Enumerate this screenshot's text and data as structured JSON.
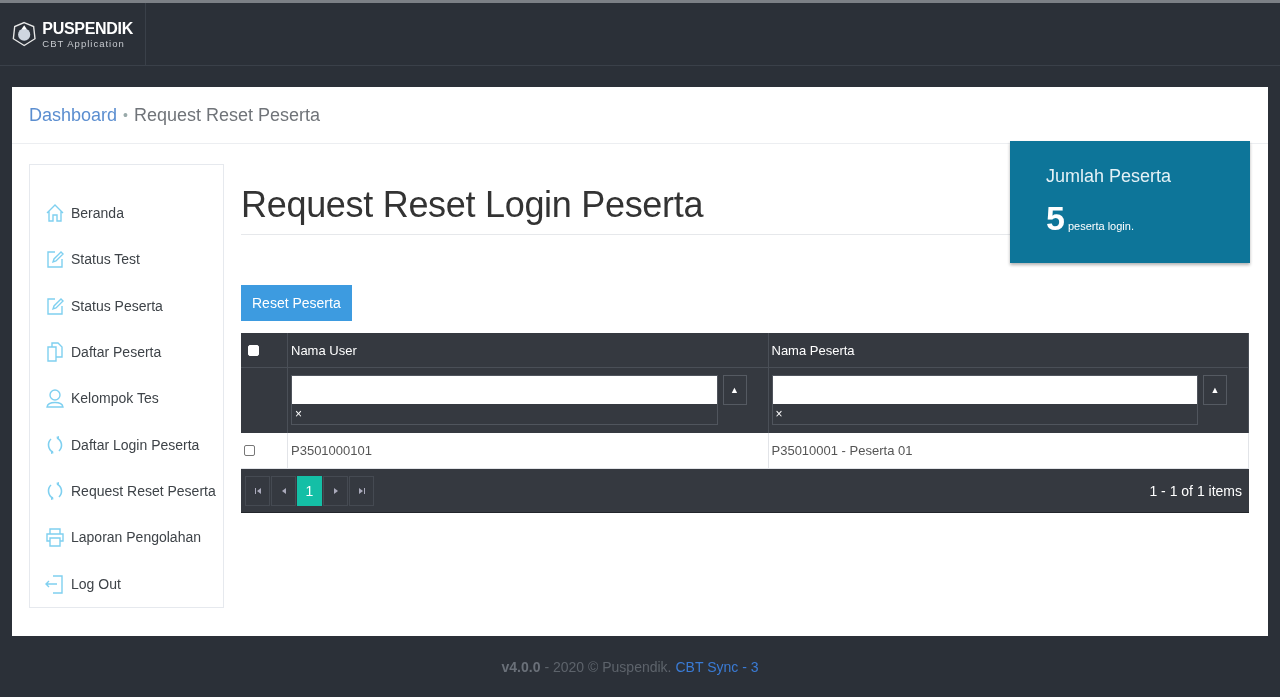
{
  "header": {
    "brand": "PUSPENDIK",
    "subtitle": "CBT Application"
  },
  "breadcrumb": {
    "items": [
      {
        "label": "Dashboard",
        "kind": "link"
      },
      {
        "label": "Request Reset Peserta",
        "kind": "current"
      }
    ],
    "separator": "•"
  },
  "sidebar": {
    "items": [
      {
        "label": "Beranda",
        "kind": "home"
      },
      {
        "label": "Status Test",
        "kind": "edit"
      },
      {
        "label": "Status Peserta",
        "kind": "edit"
      },
      {
        "label": "Daftar Peserta",
        "kind": "document"
      },
      {
        "label": "Kelompok Tes",
        "kind": "user"
      },
      {
        "label": "Daftar Login Peserta",
        "kind": "refresh"
      },
      {
        "label": "Request Reset Peserta",
        "kind": "refresh"
      },
      {
        "label": "Laporan Pengolahan",
        "kind": "printer"
      },
      {
        "label": "Log Out",
        "kind": "logout"
      }
    ]
  },
  "page_title": "Request Reset Login Peserta",
  "stat_card": {
    "title": "Jumlah Peserta",
    "count": "5",
    "unit": "peserta login."
  },
  "reset_button": "Reset Peserta",
  "table": {
    "select_all_checked": false,
    "columns": [
      {
        "label": "Nama User",
        "clear": "×",
        "sort": "▲"
      },
      {
        "label": "Nama Peserta",
        "clear": "×",
        "sort": "▲"
      }
    ],
    "rows": [
      {
        "checked": false,
        "cells": [
          "P3501000101",
          "P35010001 - Peserta 01"
        ]
      }
    ],
    "pages": [
      {
        "label": "1",
        "selected": true
      }
    ],
    "summary": "1 - 1 of 1 items"
  },
  "footer": {
    "version": "v4.0.0",
    "text": "- 2020 © Puspendik.",
    "link": "CBT Sync - 3"
  }
}
